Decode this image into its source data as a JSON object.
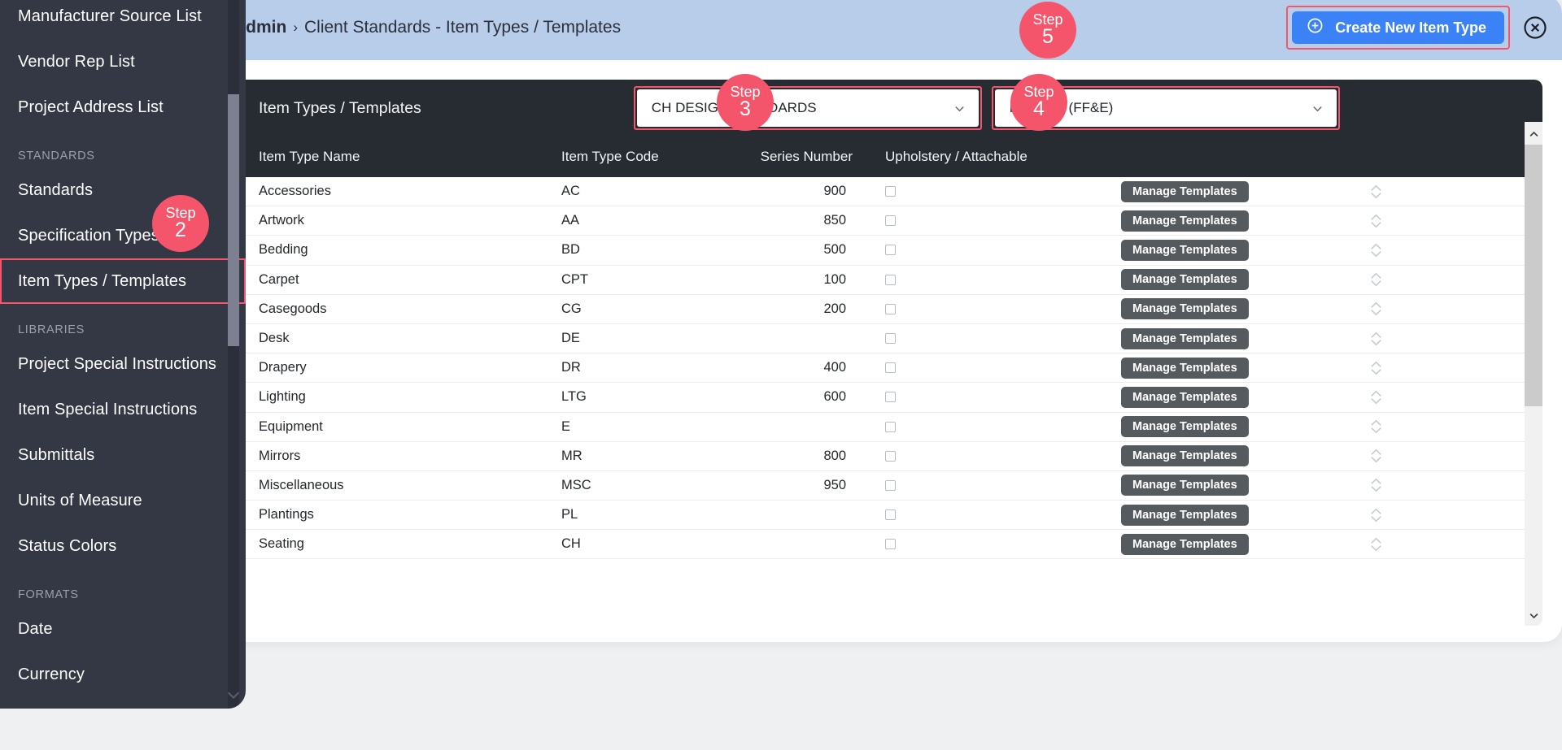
{
  "sidebar": {
    "items": [
      {
        "label": "Manufacturer Source List",
        "type": "item",
        "highlight": false
      },
      {
        "label": "Vendor Rep List",
        "type": "item",
        "highlight": false
      },
      {
        "label": "Project Address List",
        "type": "item",
        "highlight": false
      },
      {
        "label": "STANDARDS",
        "type": "section"
      },
      {
        "label": "Standards",
        "type": "item",
        "highlight": false
      },
      {
        "label": "Specification Types",
        "type": "item",
        "highlight": false
      },
      {
        "label": "Item Types / Templates",
        "type": "item",
        "highlight": true
      },
      {
        "label": "LIBRARIES",
        "type": "section"
      },
      {
        "label": "Project Special Instructions",
        "type": "item",
        "highlight": false
      },
      {
        "label": "Item Special Instructions",
        "type": "item",
        "highlight": false
      },
      {
        "label": "Submittals",
        "type": "item",
        "highlight": false
      },
      {
        "label": "Units of Measure",
        "type": "item",
        "highlight": false
      },
      {
        "label": "Status Colors",
        "type": "item",
        "highlight": false
      },
      {
        "label": "FORMATS",
        "type": "section"
      },
      {
        "label": "Date",
        "type": "item",
        "highlight": false
      },
      {
        "label": "Currency",
        "type": "item",
        "highlight": false
      }
    ]
  },
  "topbar": {
    "breadcrumb_root": "Admin",
    "breadcrumb_separator": "›",
    "breadcrumb_leaf": "Client Standards - Item Types / Templates",
    "create_button_label": "Create New Item Type",
    "background_color": "#b7cdea",
    "create_button_color": "#3b82f6"
  },
  "card": {
    "title": "Item Types / Templates",
    "dropdown_standard": {
      "value": "CH DESIGN STANDARDS"
    },
    "dropdown_category": {
      "value": "Furniture (FF&E)"
    },
    "columns": [
      "Item Type Name",
      "Item Type Code",
      "Series Number",
      "Upholstery / Attachable"
    ],
    "row_action_label": "Manage Templates",
    "rows": [
      {
        "name": "Accessories",
        "code": "AC",
        "series": "900",
        "upholstery": false
      },
      {
        "name": "Artwork",
        "code": "AA",
        "series": "850",
        "upholstery": false
      },
      {
        "name": "Bedding",
        "code": "BD",
        "series": "500",
        "upholstery": false
      },
      {
        "name": "Carpet",
        "code": "CPT",
        "series": "100",
        "upholstery": false
      },
      {
        "name": "Casegoods",
        "code": "CG",
        "series": "200",
        "upholstery": false
      },
      {
        "name": "Desk",
        "code": "DE",
        "series": "",
        "upholstery": false
      },
      {
        "name": "Drapery",
        "code": "DR",
        "series": "400",
        "upholstery": false
      },
      {
        "name": "Lighting",
        "code": "LTG",
        "series": "600",
        "upholstery": false
      },
      {
        "name": "Equipment",
        "code": "E",
        "series": "",
        "upholstery": false
      },
      {
        "name": "Mirrors",
        "code": "MR",
        "series": "800",
        "upholstery": false
      },
      {
        "name": "Miscellaneous",
        "code": "MSC",
        "series": "950",
        "upholstery": false
      },
      {
        "name": "Plantings",
        "code": "PL",
        "series": "",
        "upholstery": false
      },
      {
        "name": "Seating",
        "code": "CH",
        "series": "",
        "upholstery": false
      }
    ]
  },
  "steps": [
    {
      "word": "Step",
      "num": "2"
    },
    {
      "word": "Step",
      "num": "3"
    },
    {
      "word": "Step",
      "num": "4"
    },
    {
      "word": "Step",
      "num": "5"
    }
  ]
}
